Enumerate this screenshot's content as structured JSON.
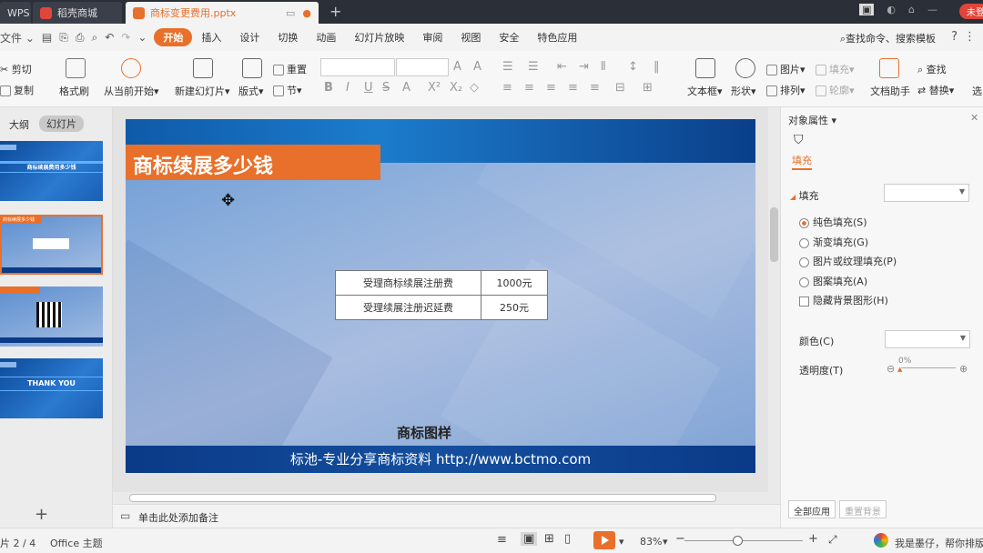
{
  "titlebar": {
    "tabs": [
      {
        "label": "WPS"
      },
      {
        "label": "稻壳商城"
      },
      {
        "label": "商标变更费用.pptx"
      }
    ],
    "login_label": "未登"
  },
  "menubar": {
    "file_label": "文件",
    "items": [
      "开始",
      "插入",
      "设计",
      "切换",
      "动画",
      "幻灯片放映",
      "审阅",
      "视图",
      "安全",
      "特色应用"
    ],
    "search_label": "查找命令、搜索模板",
    "help_label": "?"
  },
  "ribbon": {
    "cut": "剪切",
    "copy": "复制",
    "format_painter": "格式刷",
    "play_from_current": "从当前开始",
    "new_slide": "新建幻灯片",
    "layout": "版式",
    "section": "节",
    "reset": "重置",
    "textbox": "文本框",
    "shape": "形状",
    "picture": "图片",
    "fill": "填充",
    "arrange": "排列",
    "outline": "轮廓",
    "doc_helper": "文档助手",
    "find": "查找",
    "replace": "替换",
    "select": "选"
  },
  "leftpanel": {
    "tab_outline": "大纲",
    "tab_slides": "幻灯片",
    "thumbs": [
      {
        "title": "商标续展费用多少钱"
      },
      {
        "title": "商标续展多少钱"
      },
      {
        "title": ""
      },
      {
        "title": "THANK YOU"
      }
    ],
    "add_label": "+"
  },
  "slide": {
    "title": "商标续展多少钱",
    "table": [
      [
        "受理商标续展注册费",
        "1000元"
      ],
      [
        "受理续展注册迟延费",
        "250元"
      ]
    ],
    "caption": "商标图样",
    "footer": "标池-专业分享商标资料 http://www.bctmo.com"
  },
  "notes": {
    "placeholder": "单击此处添加备注"
  },
  "rightpane": {
    "title": "对象属性",
    "fill_tab": "填充",
    "fill_section": "填充",
    "options": [
      "纯色填充(S)",
      "渐变填充(G)",
      "图片或纹理填充(P)",
      "图案填充(A)"
    ],
    "hide_bg": "隐藏背景图形(H)",
    "color_label": "颜色(C)",
    "transparency_label": "透明度(T)",
    "transparency_value": "0%",
    "apply_all": "全部应用",
    "reset_bg": "重置背景"
  },
  "statusbar": {
    "slide_counter": "片 2 / 4",
    "theme": "Office 主题",
    "zoom": "83%",
    "assistant": "我是墨仔，帮你排版"
  },
  "colors": {
    "accent": "#e8702a",
    "slide_blue": "#0e5aa8"
  }
}
